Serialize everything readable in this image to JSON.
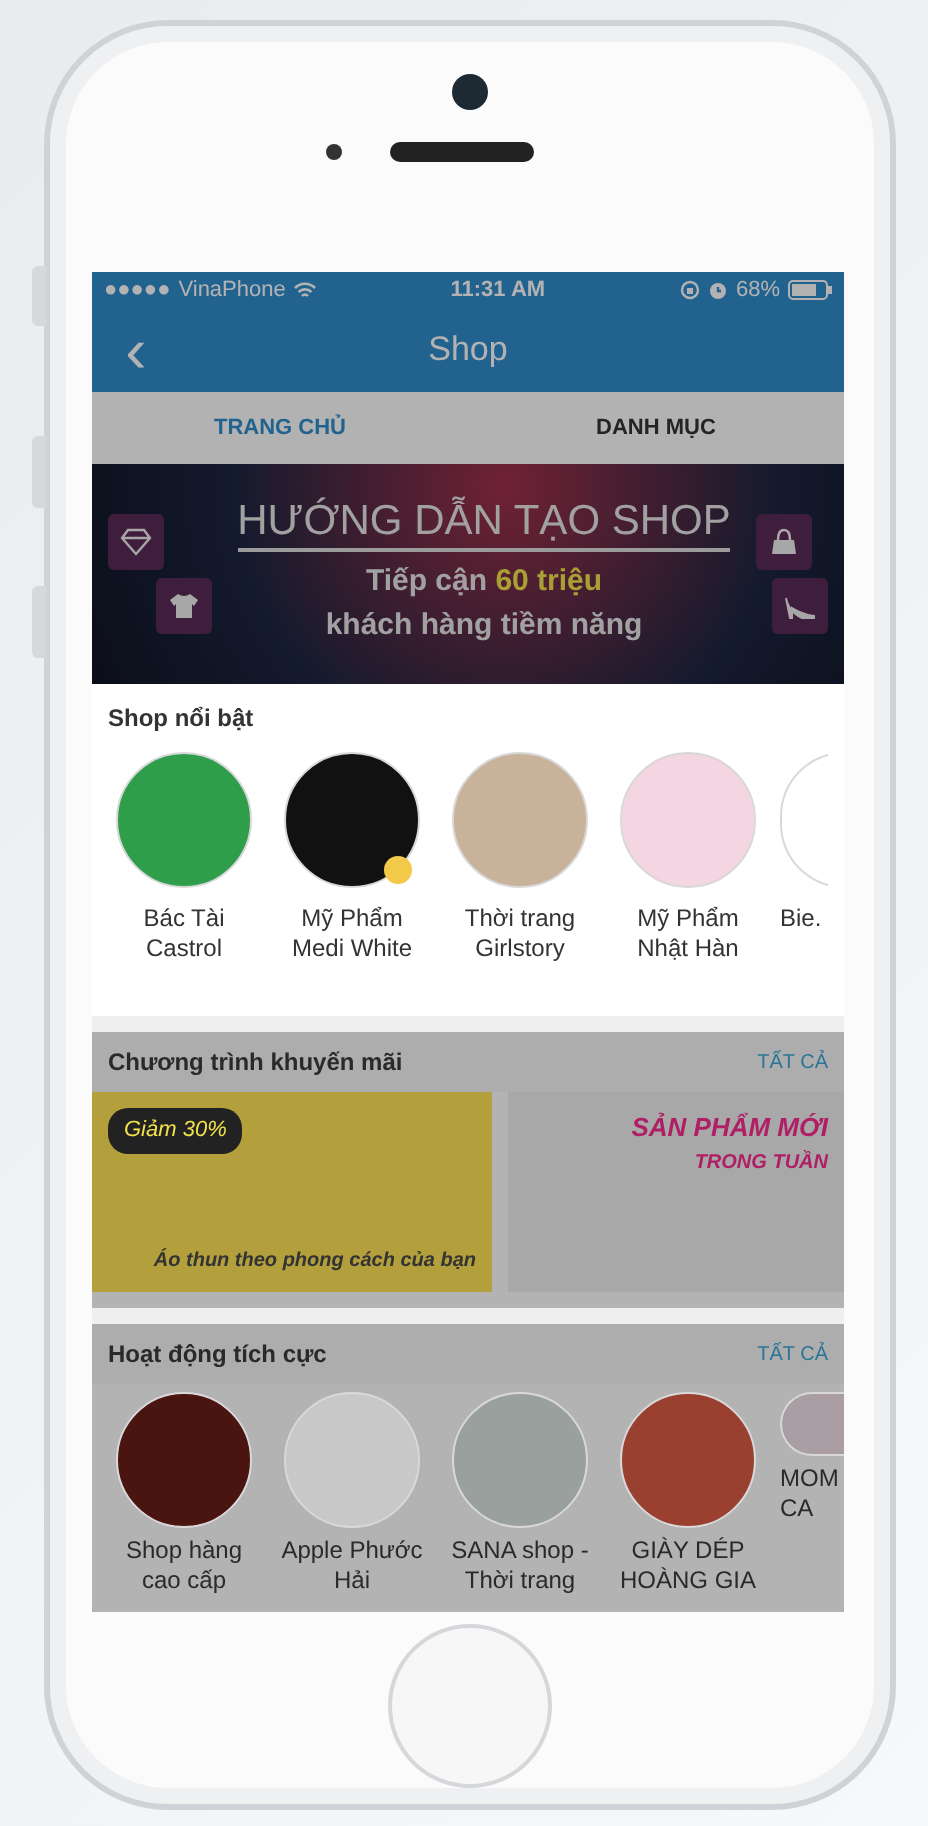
{
  "status_bar": {
    "dimmed": true,
    "signal": "●●●●●",
    "carrier": "VinaPhone",
    "time": "11:31 AM",
    "battery": "68%"
  },
  "nav_bar": {
    "dimmed": true,
    "back": "‹",
    "title": "Shop"
  },
  "tabs": {
    "dimmed": true,
    "items": [
      {
        "label": "TRANG CHỦ",
        "selected": true
      },
      {
        "label": "DANH MỤC",
        "selected": false
      }
    ]
  },
  "banner": {
    "dimmed": true,
    "title": "HƯỚNG DẪN TẠO SHOP",
    "line_1": "Tiếp cận **60 triệu**",
    "line_2": "khách hàng tiềm năng"
  },
  "featured_shops": {
    "dimmed": false,
    "title": "Shop nổi bật",
    "shops": [
      {
        "name": "Bác Tài Castrol",
        "color": "#2f9e4a",
        "verified": false
      },
      {
        "name": "Mỹ Phẩm Medi White",
        "color": "#111111",
        "verified": true
      },
      {
        "name": "Thời trang Girlstory",
        "color": "#c9b29a",
        "verified": false
      },
      {
        "name": "Mỹ Phẩm Nhật Hàn",
        "color": "#f3d6e2",
        "verified": false
      },
      {
        "name": "Bie.",
        "color": "#ffffff",
        "verified": false
      }
    ]
  },
  "promotions": {
    "dimmed": true,
    "title": "Chương trình khuyến mãi",
    "see_all": "TẤT CẢ",
    "items": [
      {
        "badge": "Giảm 30%",
        "caption": "Áo thun theo phong cách của bạn",
        "color": "#b3a03c"
      },
      {
        "badge": "SẢN PHẨM MỚI",
        "caption": "TRONG TUẦN",
        "color": "#a8a8a8"
      }
    ]
  },
  "active_shops": {
    "dimmed": true,
    "title": "Hoạt động tích cực",
    "see_all": "TẤT CẢ",
    "shops": [
      {
        "name": "Shop hàng cao cấp",
        "color": "#4a1410"
      },
      {
        "name": "Apple Phước Hải",
        "color": "#c8c8c8"
      },
      {
        "name": "SANA shop - Thời trang",
        "color": "#9aa09e"
      },
      {
        "name": "GIÀY DÉP HOÀNG GIA",
        "color": "#9a4030"
      },
      {
        "name": "MOM CA",
        "color": "#aa9ea4"
      }
    ]
  }
}
